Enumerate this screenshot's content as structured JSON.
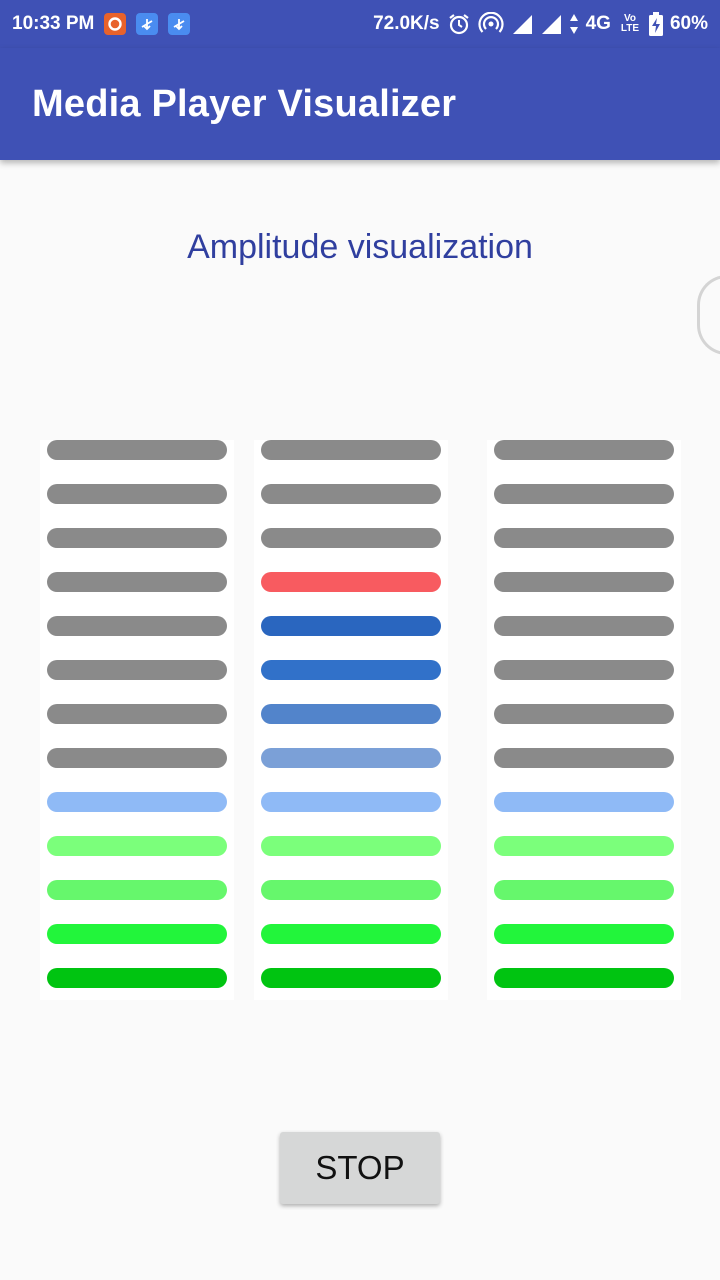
{
  "status_bar": {
    "time": "10:33 PM",
    "net_speed": "72.0K/s",
    "network": "4G",
    "volte": "Vo LTE",
    "battery": "60%"
  },
  "app_bar": {
    "title": "Media Player Visualizer"
  },
  "main": {
    "heading": "Amplitude visualization",
    "stop_label": "STOP"
  },
  "visualizer": {
    "segments_per_column": 13,
    "colors": {
      "inactive": "#8a8a8a",
      "peak": "#f85b60",
      "blue_dark": "#2a66bf",
      "blue_mid": "#3171c9",
      "blue_soft": "#5284cb",
      "blue_light": "#7ba0d7",
      "sky": "#8fbaf6",
      "green_pale": "#7bff7b",
      "green_light": "#66f76c",
      "green_bright": "#22f53b",
      "green_dark": "#00c411"
    },
    "columns": [
      {
        "name": "left",
        "segments": [
          "inactive",
          "inactive",
          "inactive",
          "inactive",
          "inactive",
          "inactive",
          "inactive",
          "inactive",
          "sky",
          "green_pale",
          "green_light",
          "green_bright",
          "green_dark"
        ]
      },
      {
        "name": "center",
        "segments": [
          "inactive",
          "inactive",
          "inactive",
          "peak",
          "blue_dark",
          "blue_mid",
          "blue_soft",
          "blue_light",
          "sky",
          "green_pale",
          "green_light",
          "green_bright",
          "green_dark"
        ]
      },
      {
        "name": "right",
        "segments": [
          "inactive",
          "inactive",
          "inactive",
          "inactive",
          "inactive",
          "inactive",
          "inactive",
          "inactive",
          "sky",
          "green_pale",
          "green_light",
          "green_bright",
          "green_dark"
        ]
      }
    ]
  }
}
